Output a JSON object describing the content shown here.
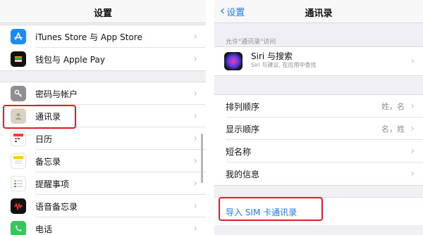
{
  "left": {
    "title": "设置",
    "groups": [
      {
        "items": [
          {
            "label": "iTunes Store 与 App Store",
            "icon": "app-store-icon",
            "color": "#1a8cf5"
          },
          {
            "label": "钱包与 Apple Pay",
            "icon": "wallet-icon",
            "color": "#111111"
          }
        ]
      },
      {
        "items": [
          {
            "label": "密码与帐户",
            "icon": "key-icon",
            "color": "#8e8e93"
          },
          {
            "label": "通讯录",
            "icon": "contacts-icon",
            "color": "#d8d2c6"
          },
          {
            "label": "日历",
            "icon": "calendar-icon",
            "color": "#ffffff"
          },
          {
            "label": "备忘录",
            "icon": "notes-icon",
            "color": "#ffffff"
          },
          {
            "label": "提醒事项",
            "icon": "reminders-icon",
            "color": "#ffffff"
          },
          {
            "label": "语音备忘录",
            "icon": "voice-memos-icon",
            "color": "#111111"
          },
          {
            "label": "电话",
            "icon": "phone-icon",
            "color": "#34c759"
          }
        ]
      }
    ]
  },
  "right": {
    "back_label": "设置",
    "title": "通讯录",
    "section_header": "允许\"通讯录\"访问",
    "siri": {
      "title": "Siri 与搜索",
      "subtitle": "Siri 与建议, 在应用中查找"
    },
    "items": [
      {
        "label": "排列顺序",
        "detail": "姓，名"
      },
      {
        "label": "显示顺序",
        "detail": "名，姓"
      },
      {
        "label": "短名称",
        "detail": ""
      },
      {
        "label": "我的信息",
        "detail": ""
      }
    ],
    "import_label": "导入 SIM 卡通讯录"
  },
  "colors": {
    "accent": "#1a7cf5",
    "highlight": "#e51c23"
  }
}
